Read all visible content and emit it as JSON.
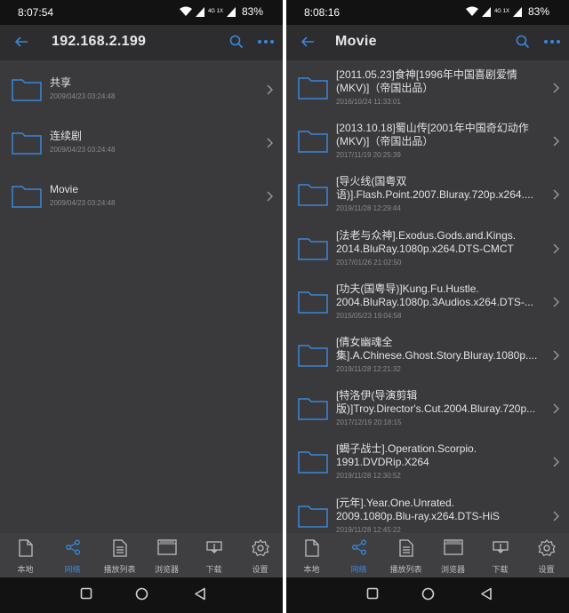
{
  "screens": [
    {
      "status": {
        "time": "8:07:54",
        "battery": "83%",
        "network": "4G 1X"
      },
      "appbar": {
        "title": "192.168.2.199"
      },
      "items": [
        {
          "name": "共享",
          "date": "2009/04/23 03:24:48"
        },
        {
          "name": "连续剧",
          "date": "2009/04/23 03:24:48"
        },
        {
          "name": "Movie",
          "date": "2009/04/23 03:24:48"
        }
      ]
    },
    {
      "status": {
        "time": "8:08:16",
        "battery": "83%",
        "network": "4G 1X"
      },
      "appbar": {
        "title": "Movie"
      },
      "items": [
        {
          "line1": "[2011.05.23]食神[1996年中国喜剧爱情",
          "line2": "(MKV)]（帝国出品）",
          "date": "2016/10/24 11:33:01"
        },
        {
          "line1": "[2013.10.18]蜀山传[2001年中国奇幻动作",
          "line2": "(MKV)]（帝国出品）",
          "date": "2017/11/19 20:25:39"
        },
        {
          "line1": "[导火线(国粤双",
          "line2": "语)].Flash.Point.2007.Bluray.720p.x264....",
          "date": "2019/11/28 12:29:44"
        },
        {
          "line1": "[法老与众神].Exodus.Gods.and.Kings.",
          "line2": "2014.BluRay.1080p.x264.DTS-CMCT",
          "date": "2017/01/26 21:02:50"
        },
        {
          "line1": "[功夫(国粤导)]Kung.Fu.Hustle.",
          "line2": "2004.BluRay.1080p.3Audios.x264.DTS-...",
          "date": "2015/05/23 19:04:58"
        },
        {
          "line1": "[倩女幽魂全",
          "line2": "集].A.Chinese.Ghost.Story.Bluray.1080p....",
          "date": "2019/11/28 12:21:32"
        },
        {
          "line1": "[特洛伊(导演剪辑",
          "line2": "版)]Troy.Director's.Cut.2004.Bluray.720p...",
          "date": "2017/12/19 20:18:15"
        },
        {
          "line1": "[蝎子战士].Operation.Scorpio.",
          "line2": "1991.DVDRip.X264",
          "date": "2019/11/28 12:30:52"
        },
        {
          "line1": "[元年].Year.One.Unrated.",
          "line2": "2009.1080p.Blu-ray.x264.DTS-HiS",
          "date": "2019/11/28 12:45:22"
        }
      ]
    }
  ],
  "tabs": [
    {
      "label": "本地",
      "icon": "file-icon"
    },
    {
      "label": "网络",
      "icon": "share-icon",
      "active": true
    },
    {
      "label": "播放列表",
      "icon": "playlist-icon"
    },
    {
      "label": "浏览器",
      "icon": "browser-icon"
    },
    {
      "label": "下载",
      "icon": "download-icon"
    },
    {
      "label": "设置",
      "icon": "gear-icon"
    }
  ],
  "colors": {
    "accent": "#3b86d8",
    "background": "#3a3a3c",
    "appbar": "#2d2d2f",
    "tabbar": "#3f3f41"
  }
}
